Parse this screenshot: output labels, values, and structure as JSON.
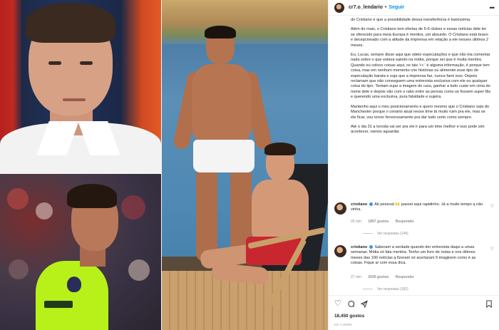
{
  "post": {
    "username": "cr7.o_lendario",
    "separator": "•",
    "follow_label": "Seguir",
    "more_label": "•••",
    "caption": [
      "do Cristiano e que a possibilidade dessa transferência é baixíssima.",
      "Além do mais, o Cristiano tem ofertas de 5-6 clubes e essas notícias dele ter se oferecido para meia Europa é mentira, um absurdo. O Cristiano está bravo e decepcionado com a atitude da imprensa em relação a ele nesses últimos 2 meses.",
      "Eu, Lucas, sempre disse aqui que odeio especulações e que não iria comentar nada sobre o que estava saindo na mídia, porque sei que é muita mentira. Quando eu coloco coisas aqui, os tais '👀' é alguma informação, é porque tem coisa, mas em nenhum momento crie histórias ou alimentei esse tipo de especulação barata e suja que a imprensa faz, nunca farei isso. Depois reclamam que não conseguem uma entrevista exclusiva com ele ou qualquer coisa do tipo. Tentam sujar a imagem do cara, ganhar a todo custo em cima do nome dele e depois vão com o rabo entre as pernas como se fossem super fãs e querendo uma exclusiva, pura falsidade e sujeira.",
      "Mantenho aqui o meu posicionamento e quero mesmo que o Cristiano saia do Manchester porque o cenário atual nesse time tá muito ruim pra ele, mas se ele ficar, vou torcer fervorosamente pra dar tudo certo como sempre.",
      "Até o dia 31 a torcida vai ser pra ele ir para um time melhor e isso pode sim acontecer, vamos aguardar."
    ]
  },
  "comments": [
    {
      "user": "cristiano",
      "text": "Ab pessoal 🙌 passei aqui rapidinho. Já a muito tempo q não vinha.",
      "time": "26 min",
      "likes": "1857 gostos",
      "reply_label": "Responder",
      "replies_label": "Ver respostas (144)"
    },
    {
      "user": "cristiano",
      "text": "Saberam a verdade quando der entrevista daqui a umas semanas. Mídia só fala mentira. Tenho um livro de notas e nos últimos meses das 100 notícias q fizeram só acertaram 5 imaginem como é as coisas. Fique a/ com essa dica.",
      "time": "27 min",
      "likes": "2030 gostos",
      "reply_label": "Responder",
      "replies_label": "Ver respostas (182)"
    }
  ],
  "actions": {
    "like_icon": "heart-icon",
    "comment_icon": "comment-icon",
    "share_icon": "share-icon",
    "save_icon": "bookmark-icon"
  },
  "likes_count": "18,450 gostos",
  "posted_ago": "HÁ 1 HORA",
  "colors": {
    "link_blue": "#0095f6",
    "text": "#262626",
    "muted": "#8e8e8e",
    "jersey": "#b8f01a"
  }
}
